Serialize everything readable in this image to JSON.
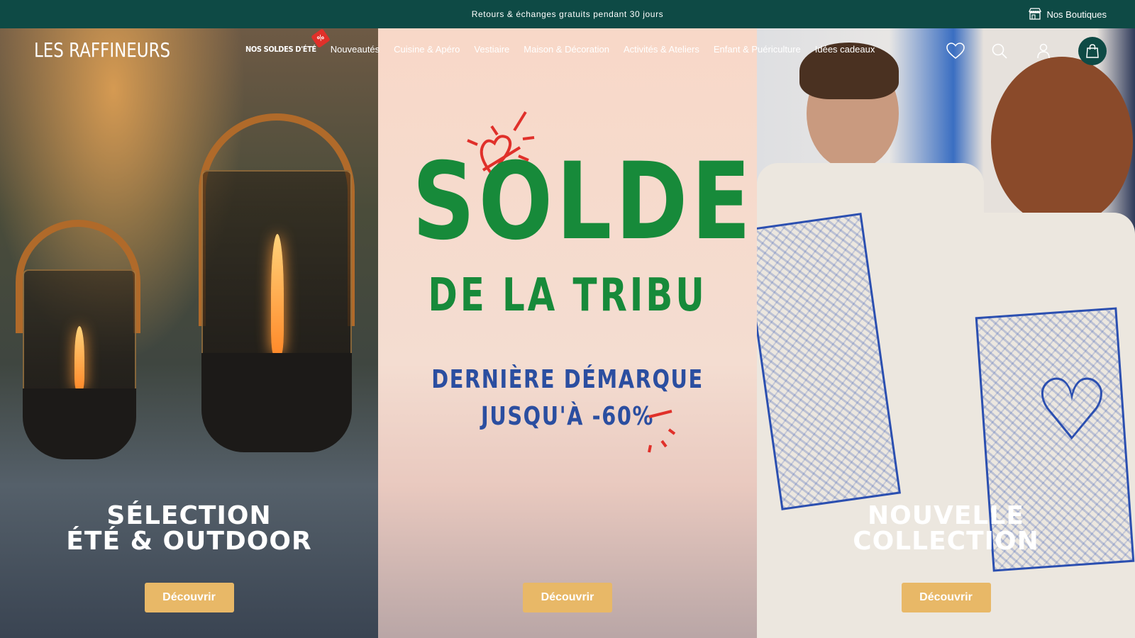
{
  "topbar": {
    "announcement": "Retours & échanges gratuits pendant 30 jours",
    "stores_label": "Nos Boutiques"
  },
  "header": {
    "logo": "LES RAFFINEURS",
    "nav": [
      {
        "label": "NOS SOLDES D'ÉTÉ",
        "badge": "%"
      },
      {
        "label": "Nouveautés"
      },
      {
        "label": "Cuisine & Apéro"
      },
      {
        "label": "Vestiaire"
      },
      {
        "label": "Maison & Décoration"
      },
      {
        "label": "Activités & Ateliers"
      },
      {
        "label": "Enfant & Puériculture"
      },
      {
        "label": "Idées cadeaux"
      }
    ],
    "icons": [
      "heart-icon",
      "search-icon",
      "user-icon",
      "bag-icon"
    ]
  },
  "panels": {
    "left": {
      "caption_line1": "SÉLECTION",
      "caption_line2": "ÉTÉ & OUTDOOR",
      "button": "Découvrir"
    },
    "middle": {
      "title": "SOLDES",
      "subtitle": "DE LA TRIBU",
      "line1": "DERNIÈRE DÉMARQUE",
      "line2": "JUSQU'À -60%",
      "button": "Découvrir"
    },
    "right": {
      "caption_line1": "NOUVELLE",
      "caption_line2": "COLLECTION",
      "button": "Découvrir"
    }
  },
  "colors": {
    "brand_green": "#0e4a45",
    "sale_green": "#178a3a",
    "sale_blue": "#2b4ea0",
    "sale_red": "#e0302a",
    "cta_gold": "#e8b867"
  }
}
